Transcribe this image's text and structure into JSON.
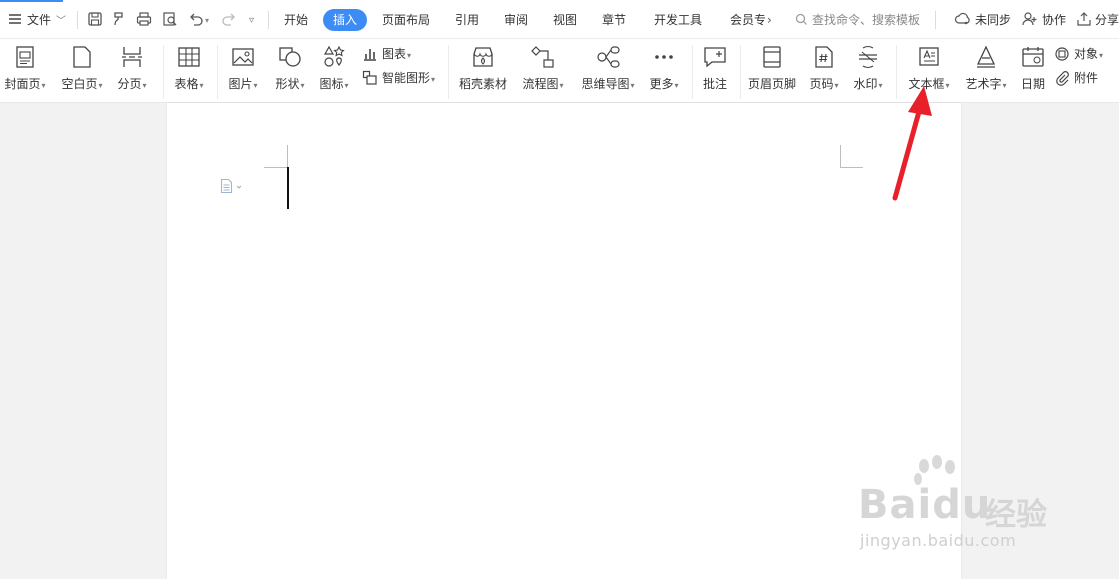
{
  "menubar": {
    "file_label": "文件",
    "tabs": [
      "开始",
      "插入",
      "页面布局",
      "引用",
      "审阅",
      "视图",
      "章节",
      "开发工具",
      "会员专"
    ],
    "active_tab": "插入",
    "search_placeholder": "查找命令、搜索模板",
    "sync_label": "未同步",
    "collab_label": "协作",
    "share_label": "分享"
  },
  "ribbon": {
    "cover": "封面页",
    "blank": "空白页",
    "page_break": "分页",
    "table": "表格",
    "picture": "图片",
    "shape": "形状",
    "icons": "图标",
    "chart": "图表",
    "smart_shape": "智能图形",
    "stock_material": "稻壳素材",
    "flowchart": "流程图",
    "mindmap": "思维导图",
    "more": "更多",
    "comment": "批注",
    "header_footer": "页眉页脚",
    "page_number": "页码",
    "watermark": "水印",
    "textbox": "文本框",
    "wordart": "艺术字",
    "date": "日期",
    "object": "对象",
    "attachment": "附件"
  },
  "colors": {
    "accent": "#3d8cf5",
    "annotation_arrow": "#e8202a"
  },
  "watermark": {
    "brand": "Baidu",
    "brand_cn": "经验",
    "url": "jingyan.baidu.com"
  }
}
